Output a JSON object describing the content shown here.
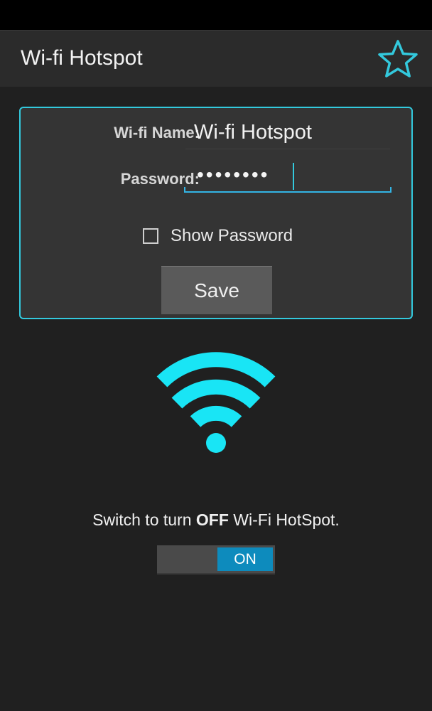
{
  "app_bar": {
    "title": "Wi-fi Hotspot",
    "favorite_icon": "star-outline-icon"
  },
  "form": {
    "name_label": "Wi-fi Name:",
    "name_value": "Wi-fi Hotspot",
    "password_label": "Password:",
    "password_value": "••••••••",
    "show_password_label": "Show Password",
    "show_password_checked": false,
    "save_label": "Save"
  },
  "status": {
    "icon": "wifi-icon",
    "message_prefix": "Switch to turn ",
    "message_bold": "OFF",
    "message_suffix": " Wi-Fi HotSpot.",
    "toggle_label": "ON",
    "toggle_on": true
  },
  "colors": {
    "accent": "#33C9DD",
    "background": "#202020",
    "toggle_active": "#0D8BBD"
  }
}
